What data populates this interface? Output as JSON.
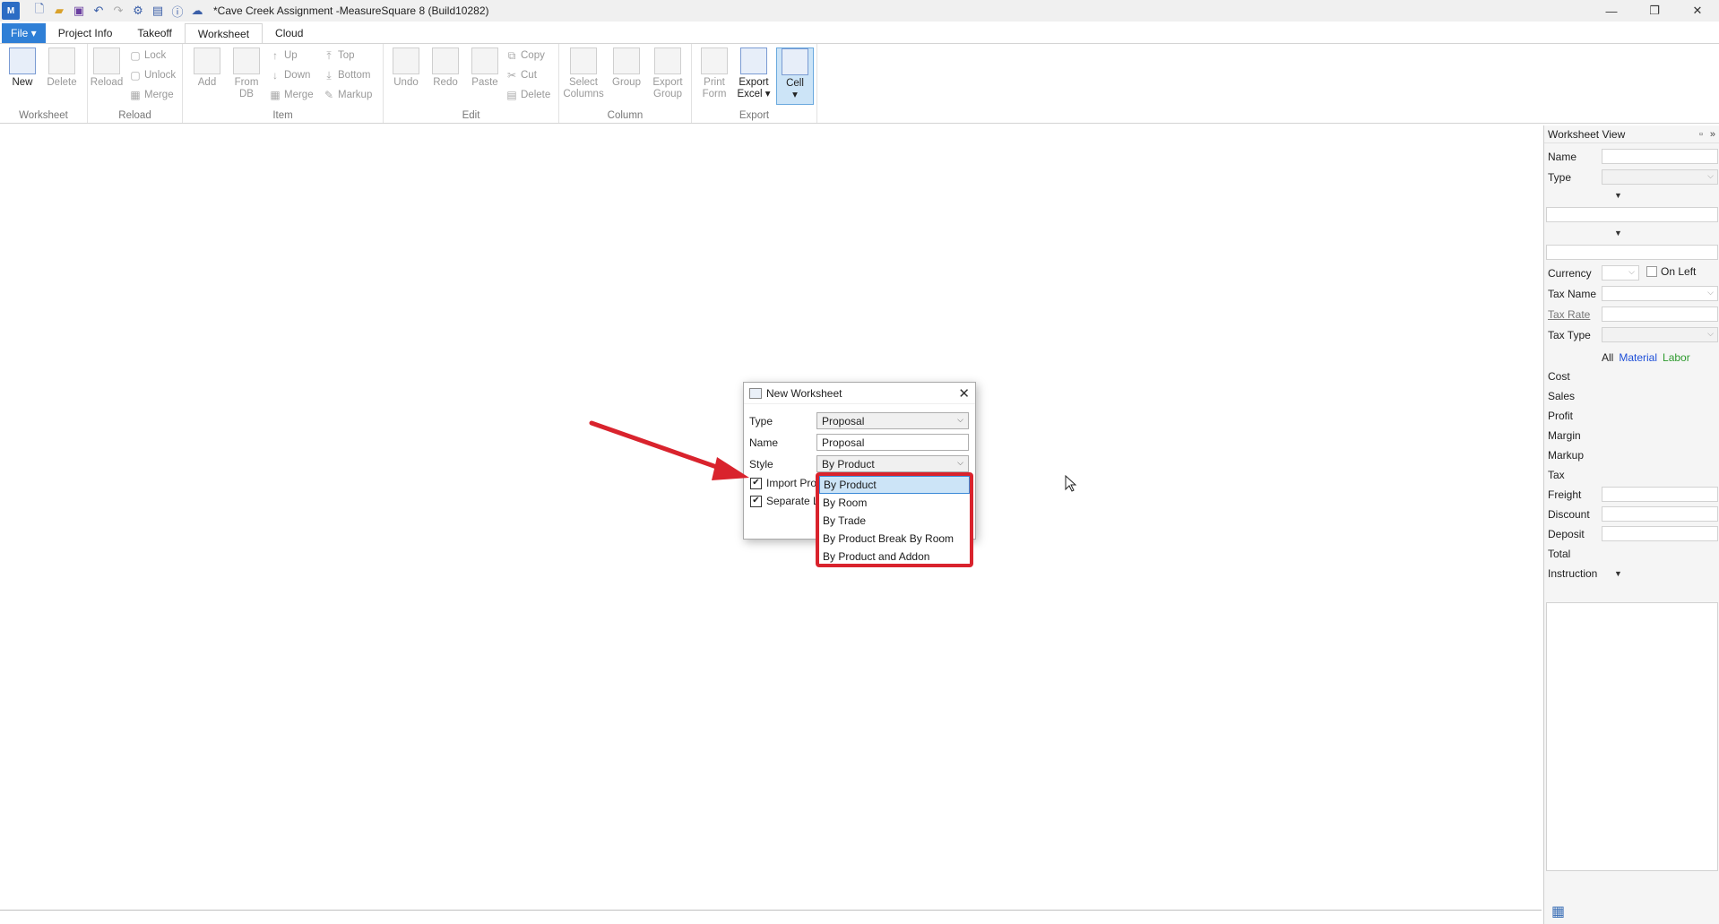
{
  "window": {
    "title": "*Cave Creek Assignment -MeasureSquare 8 (Build10282)",
    "app_icon_text": "M",
    "minimize": "—",
    "restore": "❐",
    "close": "✕"
  },
  "tabs": {
    "file": "File ▾",
    "project_info": "Project Info",
    "takeoff": "Takeoff",
    "worksheet": "Worksheet",
    "cloud": "Cloud"
  },
  "ribbon": {
    "worksheet_group": {
      "label": "Worksheet",
      "new": "New",
      "delete": "Delete"
    },
    "reload_group": {
      "label": "Reload",
      "reload": "Reload",
      "lock": "Lock",
      "unlock": "Unlock",
      "merge": "Merge"
    },
    "item_group": {
      "label": "Item",
      "add": "Add",
      "from_db": "From\nDB",
      "up": "Up",
      "down": "Down",
      "merge": "Merge",
      "top": "Top",
      "bottom": "Bottom",
      "markup": "Markup"
    },
    "edit_group": {
      "label": "Edit",
      "undo": "Undo",
      "redo": "Redo",
      "paste": "Paste",
      "copy": "Copy",
      "cut": "Cut",
      "delete": "Delete"
    },
    "column_group": {
      "label": "Column",
      "select_columns": "Select\nColumns",
      "group": "Group",
      "export_group": "Export\nGroup"
    },
    "export_group": {
      "label": "Export",
      "print_form": "Print\nForm",
      "export_excel": "Export\nExcel ▾",
      "cell": "Cell\n▾"
    }
  },
  "panel": {
    "title": "Worksheet View",
    "name_label": "Name",
    "type_label": "Type",
    "currency_label": "Currency",
    "on_left_label": "On Left",
    "tax_name_label": "Tax Name",
    "tax_rate_label": "Tax Rate",
    "tax_type_label": "Tax Type",
    "filter_all": "All",
    "filter_material": "Material",
    "filter_labor": "Labor",
    "cost_label": "Cost",
    "sales_label": "Sales",
    "profit_label": "Profit",
    "margin_label": "Margin",
    "markup_label": "Markup",
    "tax_label": "Tax",
    "freight_label": "Freight",
    "discount_label": "Discount",
    "deposit_label": "Deposit",
    "total_label": "Total",
    "instruction_label": "Instruction"
  },
  "dialog": {
    "title": "New Worksheet",
    "type_label": "Type",
    "type_value": "Proposal",
    "name_label": "Name",
    "name_value": "Proposal",
    "style_label": "Style",
    "style_value": "By Product",
    "import_label": "Import Pro",
    "separate_label": "Separate L"
  },
  "style_options": [
    "By Product",
    "By Room",
    "By Trade",
    "By Product Break By Room",
    "By Product and Addon"
  ],
  "colors": {
    "accent": "#2f7fd6",
    "annotation_red": "#d9232d",
    "selection": "#cce4f7"
  }
}
